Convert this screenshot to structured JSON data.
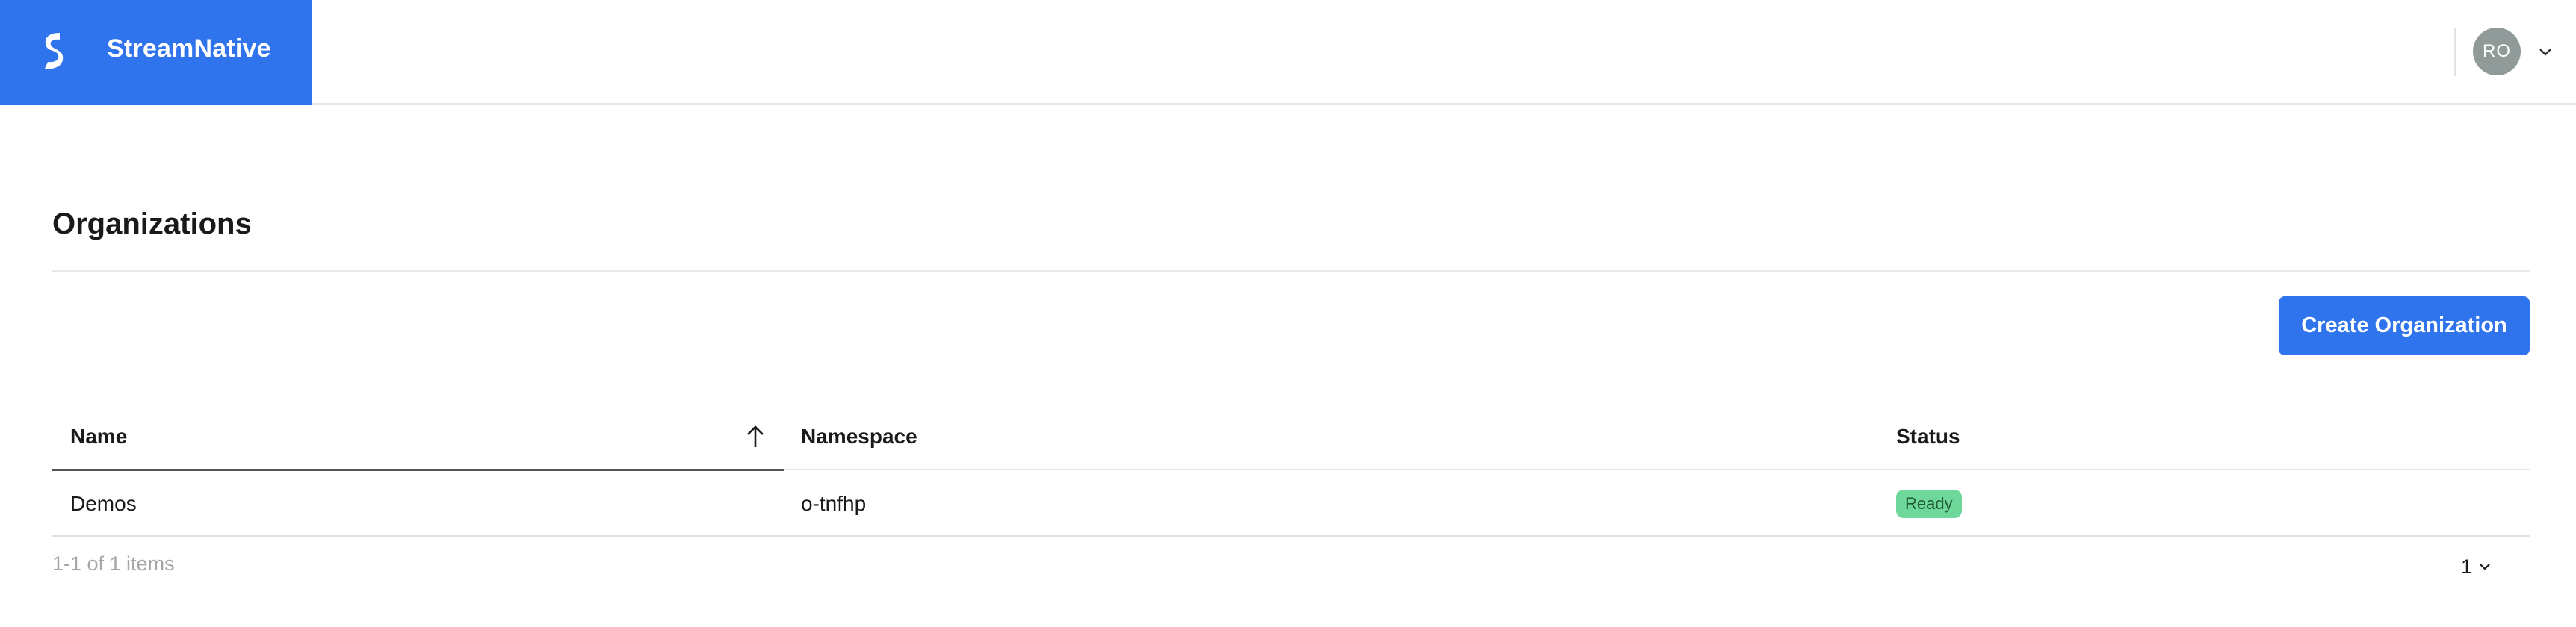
{
  "header": {
    "brand_name": "StreamNative",
    "brand_color": "#2f74ec",
    "logo_icon": "streamnative-logo-icon",
    "avatar_initials": "RO",
    "avatar_menu_icon": "chevron-down-icon"
  },
  "page": {
    "title": "Organizations",
    "create_button_label": "Create Organization"
  },
  "table": {
    "columns": [
      {
        "label": "Name",
        "sort": "ascending",
        "sort_icon": "arrow-up-icon"
      },
      {
        "label": "Namespace"
      },
      {
        "label": "Status"
      }
    ],
    "rows": [
      {
        "name": "Demos",
        "namespace": "o-tnfhp",
        "status": "Ready",
        "status_color": "#6ed89a"
      }
    ]
  },
  "footer": {
    "count_text": "1-1 of 1 items",
    "page_number": "1",
    "page_icon": "chevron-down-icon"
  }
}
